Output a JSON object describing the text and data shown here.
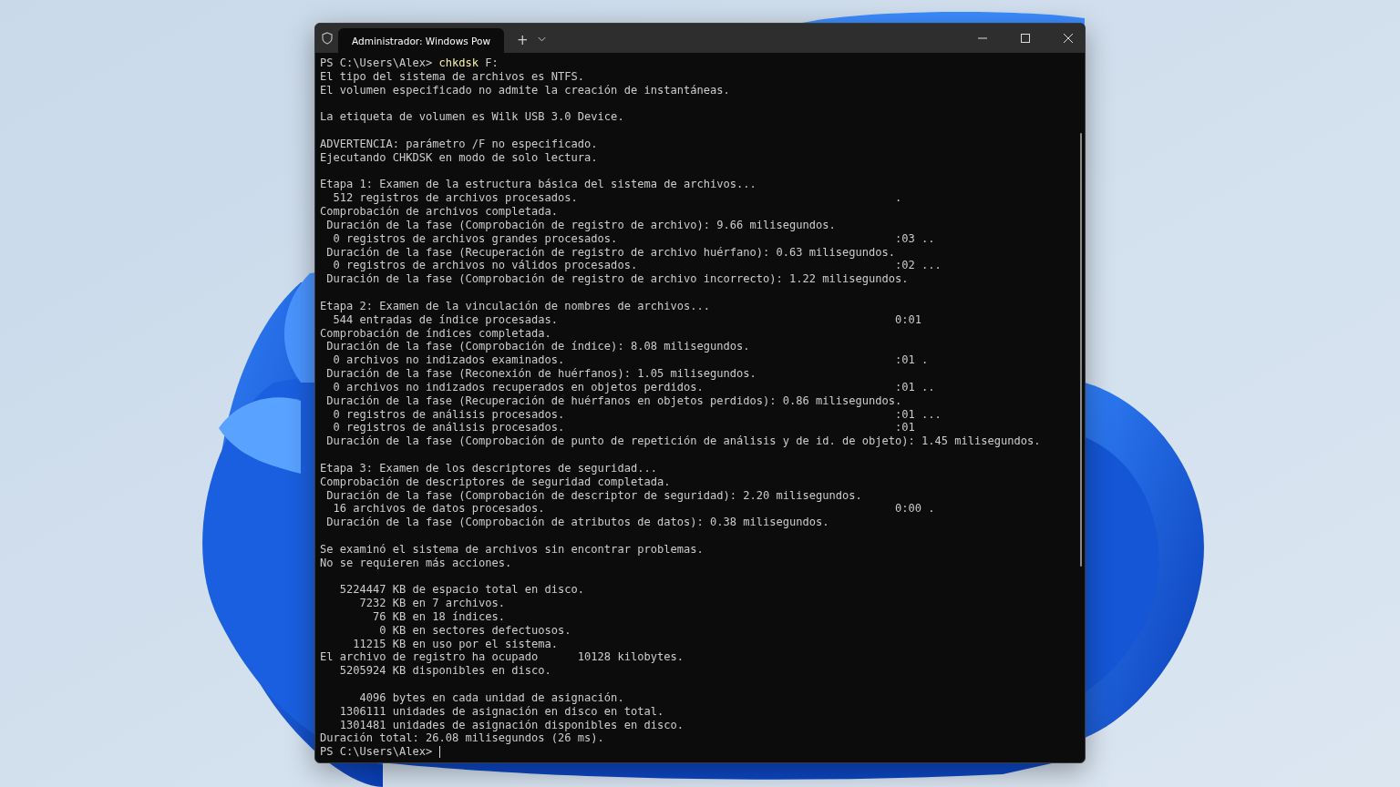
{
  "window": {
    "tab_title": "Administrador: Windows Pow",
    "new_tab": "+"
  },
  "terminal": {
    "lines": [
      {
        "kind": "prompt",
        "prompt": "PS C:\\Users\\Alex>",
        "command": "chkdsk",
        "args": "F:"
      },
      {
        "kind": "text",
        "text": "El tipo del sistema de archivos es NTFS."
      },
      {
        "kind": "text",
        "text": "El volumen especificado no admite la creación de instantáneas."
      },
      {
        "kind": "blank"
      },
      {
        "kind": "text",
        "text": "La etiqueta de volumen es Wilk USB 3.0 Device."
      },
      {
        "kind": "blank"
      },
      {
        "kind": "text",
        "text": "ADVERTENCIA: parámetro /F no especificado."
      },
      {
        "kind": "text",
        "text": "Ejecutando CHKDSK en modo de solo lectura."
      },
      {
        "kind": "blank"
      },
      {
        "kind": "text",
        "text": "Etapa 1: Examen de la estructura básica del sistema de archivos..."
      },
      {
        "kind": "text",
        "text": "  512 registros de archivos procesados.",
        "aside": "."
      },
      {
        "kind": "text",
        "text": "Comprobación de archivos completada."
      },
      {
        "kind": "text",
        "text": " Duración de la fase (Comprobación de registro de archivo): 9.66 milisegundos."
      },
      {
        "kind": "text",
        "text": "  0 registros de archivos grandes procesados.",
        "aside": ":03 .."
      },
      {
        "kind": "text",
        "text": " Duración de la fase (Recuperación de registro de archivo huérfano): 0.63 milisegundos."
      },
      {
        "kind": "text",
        "text": "  0 registros de archivos no válidos procesados.",
        "aside": ":02 ..."
      },
      {
        "kind": "text",
        "text": " Duración de la fase (Comprobación de registro de archivo incorrecto): 1.22 milisegundos."
      },
      {
        "kind": "blank"
      },
      {
        "kind": "text",
        "text": "Etapa 2: Examen de la vinculación de nombres de archivos..."
      },
      {
        "kind": "text",
        "text": "  544 entradas de índice procesadas.",
        "aside": "0:01"
      },
      {
        "kind": "text",
        "text": "Comprobación de índices completada."
      },
      {
        "kind": "text",
        "text": " Duración de la fase (Comprobación de índice): 8.08 milisegundos."
      },
      {
        "kind": "text",
        "text": "  0 archivos no indizados examinados.",
        "aside": ":01 ."
      },
      {
        "kind": "text",
        "text": " Duración de la fase (Reconexión de huérfanos): 1.05 milisegundos."
      },
      {
        "kind": "text",
        "text": "  0 archivos no indizados recuperados en objetos perdidos.",
        "aside": ":01 .."
      },
      {
        "kind": "text",
        "text": " Duración de la fase (Recuperación de huérfanos en objetos perdidos): 0.86 milisegundos."
      },
      {
        "kind": "text",
        "text": "  0 registros de análisis procesados.",
        "aside": ":01 ..."
      },
      {
        "kind": "text",
        "text": "  0 registros de análisis procesados.",
        "aside": ":01"
      },
      {
        "kind": "text",
        "text": " Duración de la fase (Comprobación de punto de repetición de análisis y de id. de objeto): 1.45 milisegundos."
      },
      {
        "kind": "blank"
      },
      {
        "kind": "text",
        "text": "Etapa 3: Examen de los descriptores de seguridad..."
      },
      {
        "kind": "text",
        "text": "Comprobación de descriptores de seguridad completada."
      },
      {
        "kind": "text",
        "text": " Duración de la fase (Comprobación de descriptor de seguridad): 2.20 milisegundos."
      },
      {
        "kind": "text",
        "text": "  16 archivos de datos procesados.",
        "aside": "0:00 ."
      },
      {
        "kind": "text",
        "text": " Duración de la fase (Comprobación de atributos de datos): 0.38 milisegundos."
      },
      {
        "kind": "blank"
      },
      {
        "kind": "text",
        "text": "Se examinó el sistema de archivos sin encontrar problemas."
      },
      {
        "kind": "text",
        "text": "No se requieren más acciones."
      },
      {
        "kind": "blank"
      },
      {
        "kind": "text",
        "text": "   5224447 KB de espacio total en disco."
      },
      {
        "kind": "text",
        "text": "      7232 KB en 7 archivos."
      },
      {
        "kind": "text",
        "text": "        76 KB en 18 índices."
      },
      {
        "kind": "text",
        "text": "         0 KB en sectores defectuosos."
      },
      {
        "kind": "text",
        "text": "     11215 KB en uso por el sistema."
      },
      {
        "kind": "text",
        "text": "El archivo de registro ha ocupado      10128 kilobytes."
      },
      {
        "kind": "text",
        "text": "   5205924 KB disponibles en disco."
      },
      {
        "kind": "blank"
      },
      {
        "kind": "text",
        "text": "      4096 bytes en cada unidad de asignación."
      },
      {
        "kind": "text",
        "text": "   1306111 unidades de asignación en disco en total."
      },
      {
        "kind": "text",
        "text": "   1301481 unidades de asignación disponibles en disco."
      },
      {
        "kind": "text",
        "text": "Duración total: 26.08 milisegundos (26 ms)."
      },
      {
        "kind": "prompt",
        "prompt": "PS C:\\Users\\Alex>",
        "cursor": true
      }
    ]
  }
}
